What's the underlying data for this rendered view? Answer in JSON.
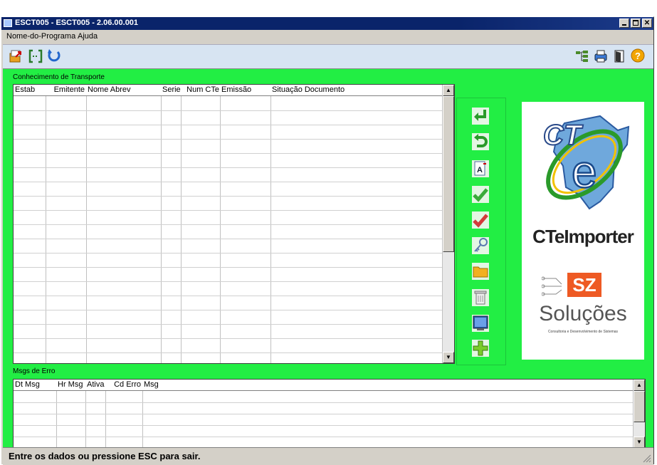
{
  "window": {
    "title": "ESCT005 - ESCT005 - 2.06.00.001"
  },
  "menu": [
    {
      "label": "Nome-do-Programa"
    },
    {
      "label": "Ajuda"
    }
  ],
  "toolbar_left_icons": [
    "export-icon",
    "bracket-icon",
    "refresh-icon"
  ],
  "toolbar_right_icons": [
    "tree-icon",
    "print-icon",
    "exit-door-icon",
    "help-icon"
  ],
  "cte_section": {
    "label": "Conhecimento de Transporte",
    "columns": [
      "Estab",
      "Emitente",
      "Nome Abrev",
      "Serie",
      "Num CTe",
      "Emissão",
      "Situação Documento"
    ]
  },
  "action_buttons": [
    "enter-arrow-icon",
    "undo-icon",
    "document-a-icon",
    "check-green-icon",
    "check-red-icon",
    "key-icon",
    "folder-icon",
    "trash-icon",
    "monitor-icon",
    "add-icon"
  ],
  "logo": {
    "cte_text": "CT",
    "cte_e": "e",
    "product": "CTeImporter",
    "brand_badge": "SZ",
    "brand": "Soluções",
    "tagline": "Consultoria e Desenvolvimento de Sistemas"
  },
  "errors_section": {
    "label": "Msgs de Erro",
    "columns": [
      "Dt Msg",
      "Hr Msg",
      "Ativa",
      "Cd Erro",
      "Msg"
    ]
  },
  "status": {
    "text": "Entre os dados ou pressione ESC para sair."
  },
  "colors": {
    "background_green": "#22ee44",
    "title_bar": "#0a246a"
  }
}
